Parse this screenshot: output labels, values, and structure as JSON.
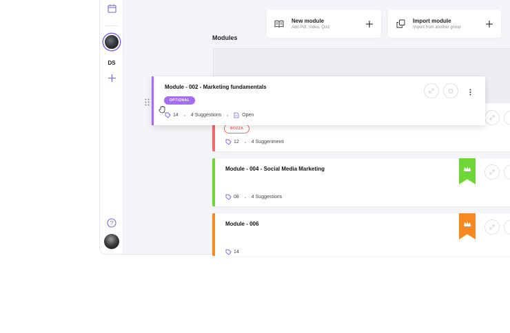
{
  "sidebar": {
    "user_initials": "DS"
  },
  "header": {
    "new_module": {
      "title": "New module",
      "subtitle": "Add Pdf, Video, Quiz"
    },
    "import_module": {
      "title": "Import module",
      "subtitle": "Import from another group"
    }
  },
  "main": {
    "section_title": "Modules",
    "dragging_module": {
      "title": "Module  - 002 - Marketing fundamentals",
      "badge": "OPTIONAL",
      "count": "14",
      "suggestions": "4 Suggestions",
      "status": "Open",
      "accent": "#a56ef0"
    },
    "modules": [
      {
        "title": "",
        "badge": "BOZZA",
        "count": "12",
        "suggestions": "4 Suggerimenti",
        "accent": "#ef6b6b"
      },
      {
        "title": "Module  - 004 - Social Media Marketing",
        "count": "08",
        "suggestions": "4 Suggestions",
        "accent": "#6fd63a"
      },
      {
        "title": "Module  - 006",
        "count": "14",
        "accent": "#f58a25"
      }
    ]
  },
  "icons": [
    "calendar-icon",
    "plus-icon",
    "help-icon",
    "book-icon",
    "copy-icon",
    "drag-handle-icon",
    "hand-cursor-icon",
    "tag-icon",
    "document-icon",
    "crown-icon",
    "expand-icon",
    "trash-icon",
    "more-icon"
  ]
}
